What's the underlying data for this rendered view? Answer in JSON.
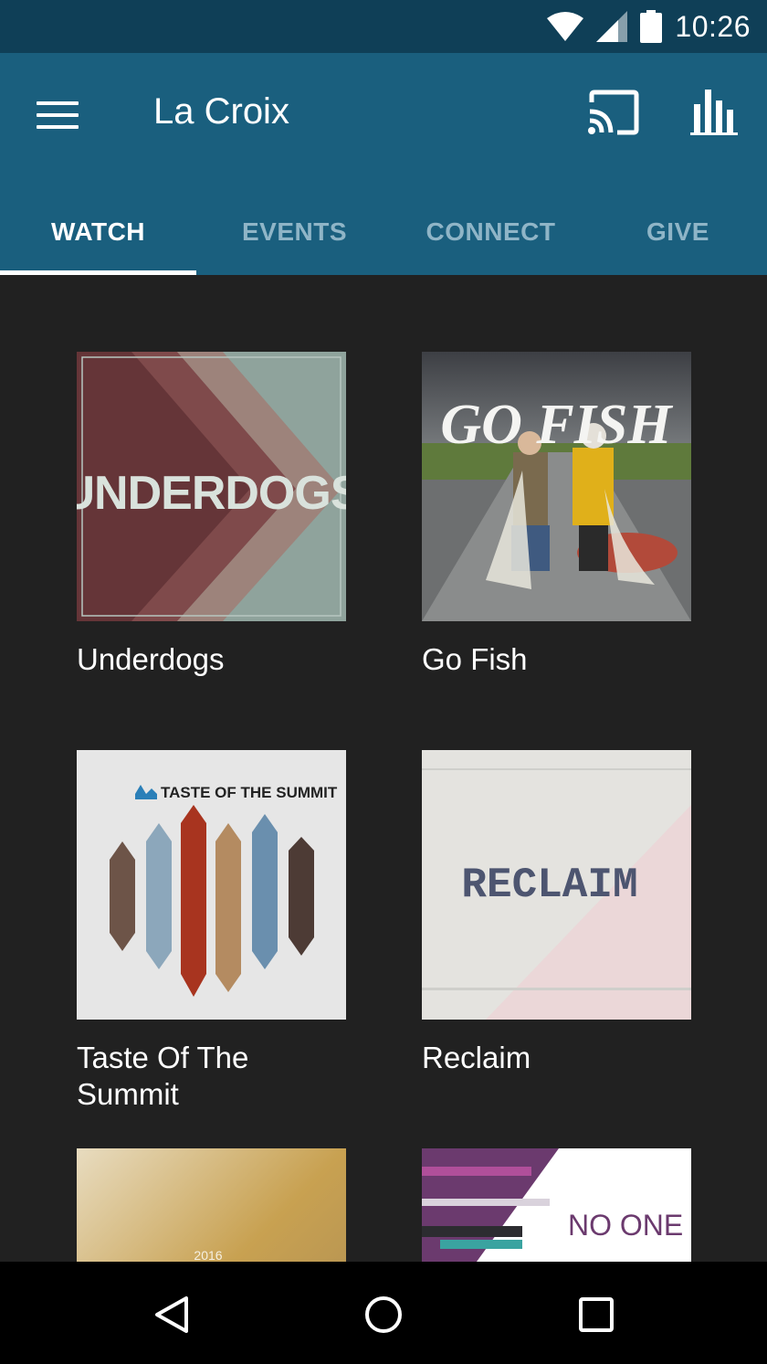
{
  "status_bar": {
    "time": "10:26",
    "icons": [
      "wifi-icon",
      "cell-signal-icon",
      "battery-icon"
    ]
  },
  "app_bar": {
    "title": "La Croix",
    "icons": [
      "menu-icon",
      "cast-icon",
      "stats-icon"
    ],
    "background_color": "#1a5f7e"
  },
  "tabs": [
    {
      "label": "WATCH",
      "active": true
    },
    {
      "label": "EVENTS",
      "active": false
    },
    {
      "label": "CONNECT",
      "active": false
    },
    {
      "label": "GIVE",
      "active": false
    }
  ],
  "series": [
    {
      "title": "Underdogs",
      "artwork_text": "UNDERDOGS"
    },
    {
      "title": "Go Fish",
      "artwork_text": "GO FISH"
    },
    {
      "title": "Taste Of The Summit",
      "artwork_text": "TASTE OF THE SUMMIT"
    },
    {
      "title": "Reclaim",
      "artwork_text": "RECLAIM"
    },
    {
      "title": "",
      "artwork_text": "2016"
    },
    {
      "title": "",
      "artwork_text": "NO ONE"
    }
  ],
  "nav_bar": {
    "icons": [
      "back-icon",
      "home-icon",
      "recents-icon"
    ]
  }
}
